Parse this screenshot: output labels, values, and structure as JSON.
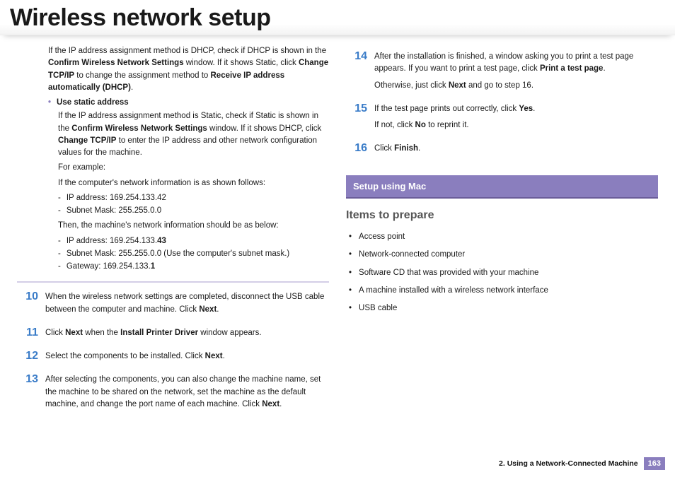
{
  "title": "Wireless network setup",
  "left": {
    "dhcp_para_pre": "If the IP address assignment method is DHCP, check if DHCP is shown in the ",
    "dhcp_bold1": "Confirm Wireless Network Settings",
    "dhcp_mid1": " window. If it shows Static, click ",
    "dhcp_bold2": "Change TCP/IP",
    "dhcp_mid2": " to change the assignment method to ",
    "dhcp_bold3": "Receive IP address automatically (DHCP)",
    "dhcp_end": ".",
    "static_label": "Use static address",
    "static_para_pre": "If the IP address assignment method is Static, check if Static is shown in the ",
    "static_bold1": "Confirm Wireless Network Settings",
    "static_mid1": " window. If it shows DHCP, click ",
    "static_bold2": "Change TCP/IP",
    "static_end": " to enter the IP address and other network configuration values for the machine.",
    "for_example": "For example:",
    "comp_info": "If the computer's network information is as shown follows:",
    "ip1": "IP address: 169.254.133.42",
    "subnet1": "Subnet Mask: 255.255.0.0",
    "then_info": "Then, the machine's network information should be as below:",
    "ip2_pre": "IP address: 169.254.133.",
    "ip2_bold": "43",
    "subnet2": "Subnet Mask: 255.255.0.0 (Use the computer's subnet mask.)",
    "gw_pre": "Gateway: 169.254.133.",
    "gw_bold": "1",
    "step10_num": "10",
    "step10_pre": "When the wireless network settings are completed, disconnect the USB cable between the computer and machine. Click ",
    "step10_bold": "Next",
    "step10_end": ".",
    "step11_num": "11",
    "step11_pre": "Click ",
    "step11_bold1": "Next",
    "step11_mid": " when the ",
    "step11_bold2": "Install Printer Driver",
    "step11_end": " window appears.",
    "step12_num": "12",
    "step12_pre": "Select the components to be installed. Click ",
    "step12_bold": "Next",
    "step12_end": ".",
    "step13_num": "13",
    "step13_pre": "After selecting the components, you can also change the machine name, set the machine to be shared on the network, set the machine as the default machine, and change the port name of each machine. Click ",
    "step13_bold": "Next",
    "step13_end": "."
  },
  "right": {
    "step14_num": "14",
    "step14_pre": "After the installation is finished, a window asking you to print a test page appears. If you want to print a test page, click ",
    "step14_bold": "Print a test page",
    "step14_end": ".",
    "step14b_pre": "Otherwise, just click ",
    "step14b_bold": "Next",
    "step14b_end": " and go to step 16.",
    "step15_num": "15",
    "step15_pre": "If the test page prints out correctly, click ",
    "step15_bold": "Yes",
    "step15_end": ".",
    "step15b_pre": "If not, click ",
    "step15b_bold": "No",
    "step15b_end": " to reprint it.",
    "step16_num": "16",
    "step16_pre": "Click ",
    "step16_bold": "Finish",
    "step16_end": ".",
    "section_bar": "Setup using Mac",
    "subhead": "Items to prepare",
    "prep1": "Access point",
    "prep2": "Network-connected computer",
    "prep3": "Software CD that was provided with your machine",
    "prep4": "A machine installed with a wireless network interface",
    "prep5": "USB cable"
  },
  "footer": {
    "chapter": "2.  Using a Network-Connected Machine",
    "page": "163"
  }
}
